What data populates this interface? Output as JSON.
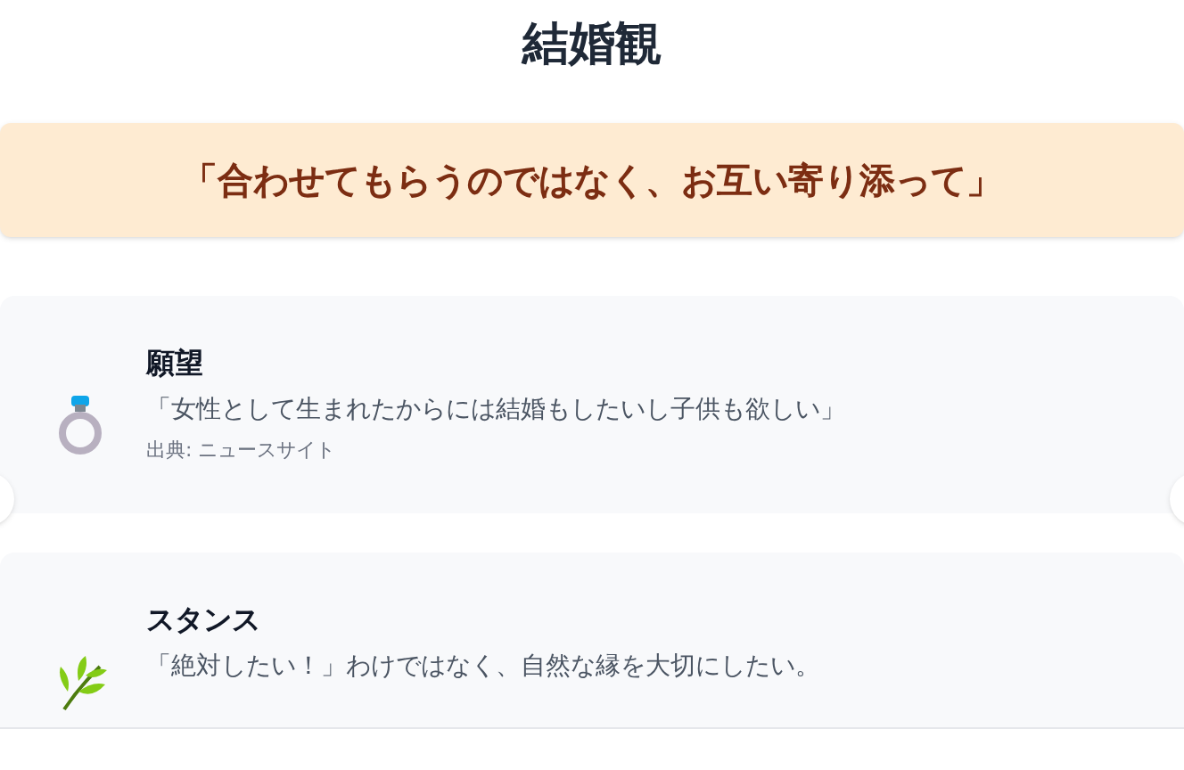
{
  "title": "結婚観",
  "banner": {
    "text": "「合わせてもらうのではなく、お互い寄り添って」"
  },
  "cards": [
    {
      "kind": "ring",
      "heading": "願望",
      "quote": "「女性として生まれたからには結婚もしたいし子供も欲しい」",
      "source": "出典: ニュースサイト"
    },
    {
      "kind": "leaf",
      "heading": "スタンス",
      "quote": "「絶対したい！」わけではなく、自然な縁を大切にしたい。"
    }
  ]
}
